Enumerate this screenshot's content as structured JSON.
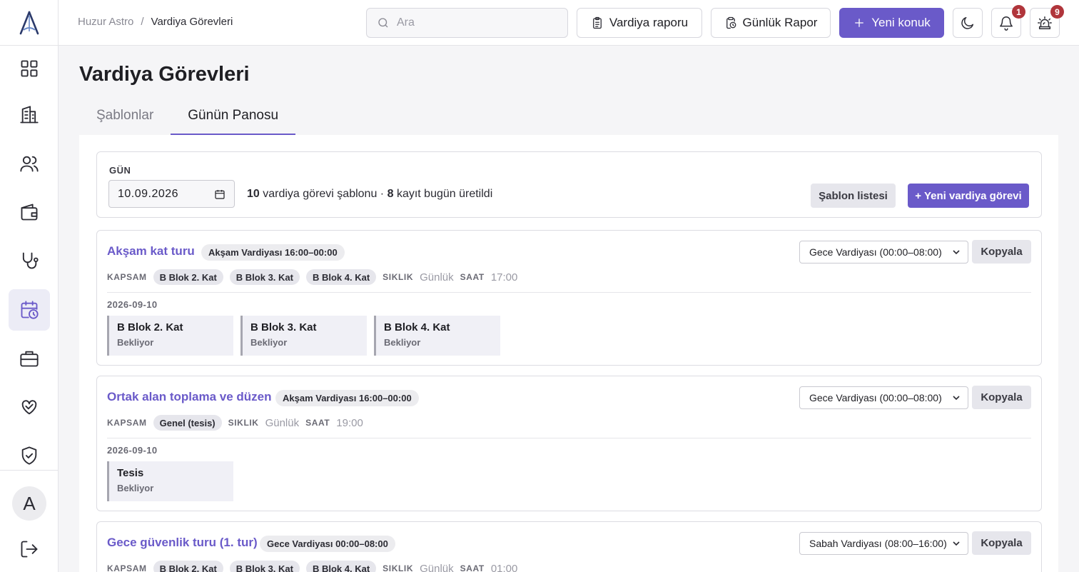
{
  "app": {
    "breadcrumb_root": "Huzur Astro",
    "breadcrumb_sep": "/",
    "breadcrumb_current": "Vardiya Görevleri"
  },
  "header": {
    "search_placeholder": "Ara",
    "shift_report_label": "Vardiya raporu",
    "daily_report_label": "Günlük Rapor",
    "new_guest_label": "Yeni konuk",
    "notifications_count": "1",
    "alarms_count": "9"
  },
  "user": {
    "avatar_initial": "A"
  },
  "page": {
    "title": "Vardiya Görevleri",
    "tabs": [
      {
        "label": "Şablonlar",
        "active": false
      },
      {
        "label": "Günün Panosu",
        "active": true
      }
    ]
  },
  "day": {
    "label": "GÜN",
    "date_value": "10.09.2026",
    "template_count": "10",
    "template_text": "vardiya görevi şablonu ·",
    "record_count": "8",
    "record_text": "kayıt bugün üretildi",
    "template_list_button": "Şablon listesi",
    "new_task_button": "+ Yeni vardiya görevi"
  },
  "labels": {
    "scope": "KAPSAM",
    "frequency": "SIKLIK",
    "time": "SAAT",
    "copy": "Kopyala"
  },
  "tasks": [
    {
      "title": "Akşam kat turu",
      "shift_tag": "Akşam Vardiyası 16:00–00:00",
      "target_shift": "Gece Vardiyası (00:00–08:00)",
      "scope": [
        "B Blok 2. Kat",
        "B Blok 3. Kat",
        "B Blok 4. Kat"
      ],
      "frequency": "Günlük",
      "time": "17:00",
      "run_date": "2026-09-10",
      "runs": [
        {
          "name": "B Blok 2. Kat",
          "status": "Bekliyor"
        },
        {
          "name": "B Blok 3. Kat",
          "status": "Bekliyor"
        },
        {
          "name": "B Blok 4. Kat",
          "status": "Bekliyor"
        }
      ]
    },
    {
      "title": "Ortak alan toplama ve düzen",
      "shift_tag": "Akşam Vardiyası 16:00–00:00",
      "target_shift": "Gece Vardiyası (00:00–08:00)",
      "scope": [
        "Genel (tesis)"
      ],
      "frequency": "Günlük",
      "time": "19:00",
      "run_date": "2026-09-10",
      "runs": [
        {
          "name": "Tesis",
          "status": "Bekliyor"
        }
      ]
    },
    {
      "title": "Gece güvenlik turu (1. tur)",
      "shift_tag": "Gece Vardiyası 00:00–08:00",
      "target_shift": "Sabah Vardiyası (08:00–16:00)",
      "scope": [
        "B Blok 2. Kat",
        "B Blok 3. Kat",
        "B Blok 4. Kat"
      ],
      "frequency": "Günlük",
      "time": "01:00"
    }
  ],
  "colors": {
    "accent": "#6a5ac9",
    "badge": "#b0353b"
  },
  "icons": {
    "sidebar": [
      "dashboard-grid-icon",
      "building-icon",
      "users-icon",
      "wallet-icon",
      "stethoscope-icon",
      "calendar-clock-icon",
      "briefcase-icon",
      "heart-hands-icon",
      "shield-check-icon"
    ],
    "header": [
      "search-icon",
      "clipboard-icon",
      "clipboard-clock-icon",
      "plus-icon",
      "moon-icon",
      "bell-icon",
      "alarm-light-icon"
    ]
  }
}
